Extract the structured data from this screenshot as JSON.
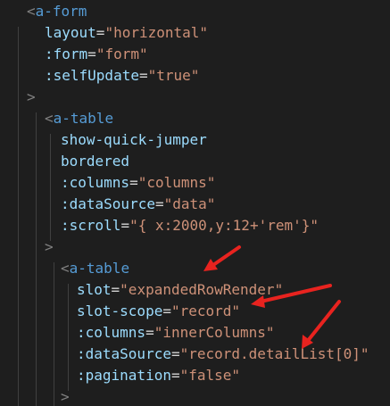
{
  "code": {
    "line1": {
      "open": "<",
      "tag": "a-form"
    },
    "line2": {
      "attr": "layout",
      "eq": "=",
      "value": "\"horizontal\""
    },
    "line3": {
      "attr": ":form",
      "eq": "=",
      "value": "\"form\""
    },
    "line4": {
      "attr": ":selfUpdate",
      "eq": "=",
      "value": "\"true\""
    },
    "line5": {
      "close": ">"
    },
    "line6": {
      "open": "<",
      "tag": "a-table"
    },
    "line7": {
      "attr": "show-quick-jumper"
    },
    "line8": {
      "attr": "bordered"
    },
    "line9": {
      "attr": ":columns",
      "eq": "=",
      "value": "\"columns\""
    },
    "line10": {
      "attr": ":dataSource",
      "eq": "=",
      "value": "\"data\""
    },
    "line11": {
      "attr": ":scroll",
      "eq": "=",
      "value": "\"{ x:2000,y:12+'rem'}\""
    },
    "line12": {
      "close": ">"
    },
    "line13": {
      "open": "<",
      "tag": "a-table"
    },
    "line14": {
      "attr": "slot",
      "eq": "=",
      "value": "\"expandedRowRender\""
    },
    "line15": {
      "attr": "slot-scope",
      "eq": "=",
      "value": "\"record\""
    },
    "line16": {
      "attr": ":columns",
      "eq": "=",
      "value": "\"innerColumns\""
    },
    "line17": {
      "attr": ":dataSource",
      "eq": "=",
      "value": "\"record.detailList[0]\""
    },
    "line18": {
      "attr": ":pagination",
      "eq": "=",
      "value": "\"false\""
    },
    "line19": {
      "close": ">"
    }
  },
  "colors": {
    "background": "#1e1e1e",
    "tag": "#569cd6",
    "attribute": "#9cdcfe",
    "string": "#ce9178",
    "punctuation": "#808080",
    "annotation_arrow": "#e8231f"
  }
}
